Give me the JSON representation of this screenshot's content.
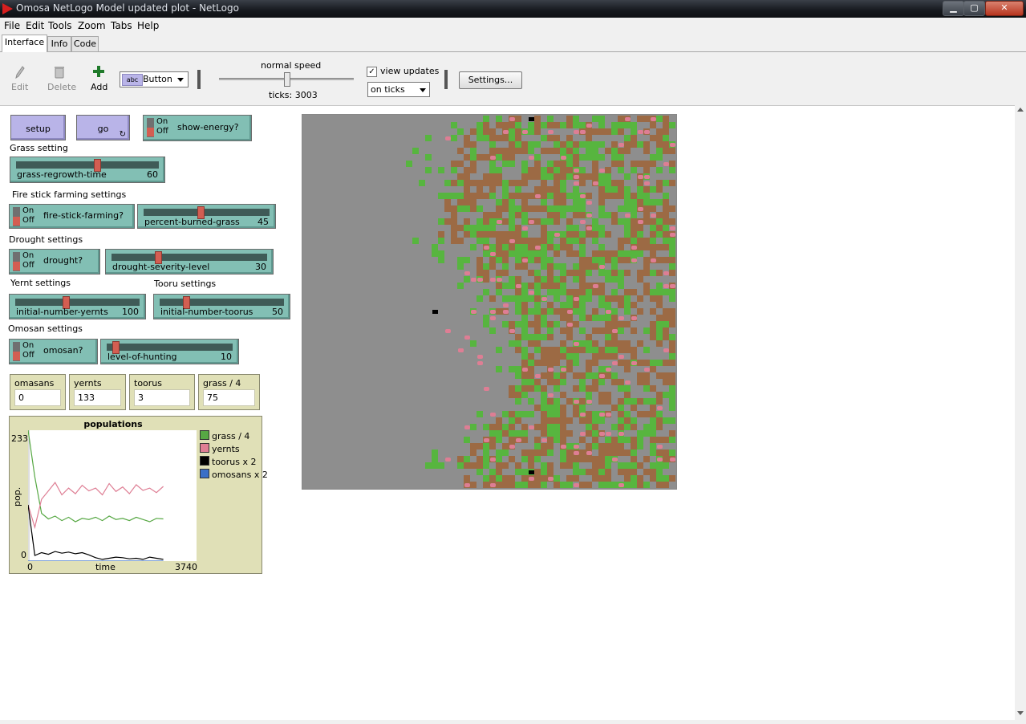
{
  "window": {
    "title": "Omosa NetLogo Model updated plot - NetLogo",
    "min": "▁",
    "max": "▢",
    "close": "✕"
  },
  "menu": [
    "File",
    "Edit",
    "Tools",
    "Zoom",
    "Tabs",
    "Help"
  ],
  "tabs": [
    "Interface",
    "Info",
    "Code"
  ],
  "toolbar": {
    "edit": "Edit",
    "delete": "Delete",
    "add": "Add",
    "widget_type": "Button",
    "widget_icon_text": "abc",
    "speed_label": "normal speed",
    "speed_level": 0.5,
    "ticks": "ticks: 3003",
    "view_updates_label": "view updates",
    "view_updates_checked": true,
    "check": "✓",
    "update_mode": "on ticks",
    "settings": "Settings..."
  },
  "widgets": {
    "setup": "setup",
    "go": "go",
    "go_icon": "↻",
    "switch_on": "On",
    "switch_off": "Off",
    "show_energy": "show-energy?",
    "grass_setting": "Grass setting",
    "grass_regrowth": {
      "name": "grass-regrowth-time",
      "value": "60",
      "level": 0.57
    },
    "fire_settings": "Fire stick farming settings",
    "fire_stick": "fire-stick-farming?",
    "percent_burned": {
      "name": "percent-burned-grass",
      "value": "45",
      "level": 0.45
    },
    "drought_settings": "Drought settings",
    "drought": "drought?",
    "drought_severity": {
      "name": "drought-severity-level",
      "value": "30",
      "level": 0.29
    },
    "yernt_settings": "Yernt settings",
    "tooru_settings": "Tooru settings",
    "initial_yernts": {
      "name": "initial-number-yernts",
      "value": "100",
      "level": 0.4
    },
    "initial_toorus": {
      "name": "initial-number-toorus",
      "value": "50",
      "level": 0.2
    },
    "omosan_settings": "Omosan settings",
    "omosan": "omosan?",
    "level_hunting": {
      "name": "level-of-hunting",
      "value": "10",
      "level": 0.05
    }
  },
  "monitors": [
    {
      "label": "omasans",
      "value": "0"
    },
    {
      "label": "yernts",
      "value": "133"
    },
    {
      "label": "toorus",
      "value": "3"
    },
    {
      "label": "grass / 4",
      "value": "75"
    }
  ],
  "colors": {
    "grass": "#57a844",
    "yernts": "#de7e94",
    "toorus": "#000000",
    "omosans": "#3a6fc7",
    "patch_grey": "#8e8e8e",
    "patch_brown": "#9c6a44",
    "patch_green": "#57b53f"
  },
  "chart_data": {
    "type": "line",
    "title": "populations",
    "xlabel": "time",
    "ylabel": "pop.",
    "xlim": [
      0,
      3740
    ],
    "ylim": [
      0,
      233
    ],
    "x_tick_labels": [
      "0",
      "3740"
    ],
    "y_tick_labels": [
      "0",
      "233"
    ],
    "legend": "right",
    "series": [
      {
        "name": "grass / 4",
        "color": "#57a844",
        "x": [
          0,
          150,
          300,
          450,
          600,
          750,
          900,
          1050,
          1200,
          1350,
          1500,
          1650,
          1800,
          1950,
          2100,
          2250,
          2400,
          2550,
          2700,
          2850,
          3003
        ],
        "values": [
          233,
          150,
          85,
          75,
          80,
          72,
          78,
          70,
          76,
          74,
          78,
          72,
          80,
          74,
          76,
          72,
          78,
          74,
          70,
          76,
          75
        ]
      },
      {
        "name": "yernts",
        "color": "#de7e94",
        "x": [
          0,
          150,
          300,
          450,
          600,
          750,
          900,
          1050,
          1200,
          1350,
          1500,
          1650,
          1800,
          1950,
          2100,
          2250,
          2400,
          2550,
          2700,
          2850,
          3003
        ],
        "values": [
          100,
          60,
          110,
          125,
          140,
          118,
          130,
          120,
          135,
          125,
          130,
          118,
          138,
          124,
          132,
          120,
          136,
          126,
          130,
          122,
          133
        ]
      },
      {
        "name": "toorus x 2",
        "color": "#000000",
        "x": [
          0,
          150,
          300,
          450,
          600,
          750,
          900,
          1050,
          1200,
          1350,
          1500,
          1650,
          1800,
          1950,
          2100,
          2250,
          2400,
          2550,
          2700,
          2850,
          3003
        ],
        "values": [
          100,
          10,
          15,
          12,
          17,
          14,
          16,
          13,
          15,
          11,
          6,
          3,
          5,
          7,
          6,
          4,
          5,
          3,
          7,
          5,
          3
        ]
      },
      {
        "name": "omosans x 2",
        "color": "#3a6fc7",
        "x": [
          0,
          3003
        ],
        "values": [
          0,
          0
        ]
      }
    ]
  }
}
